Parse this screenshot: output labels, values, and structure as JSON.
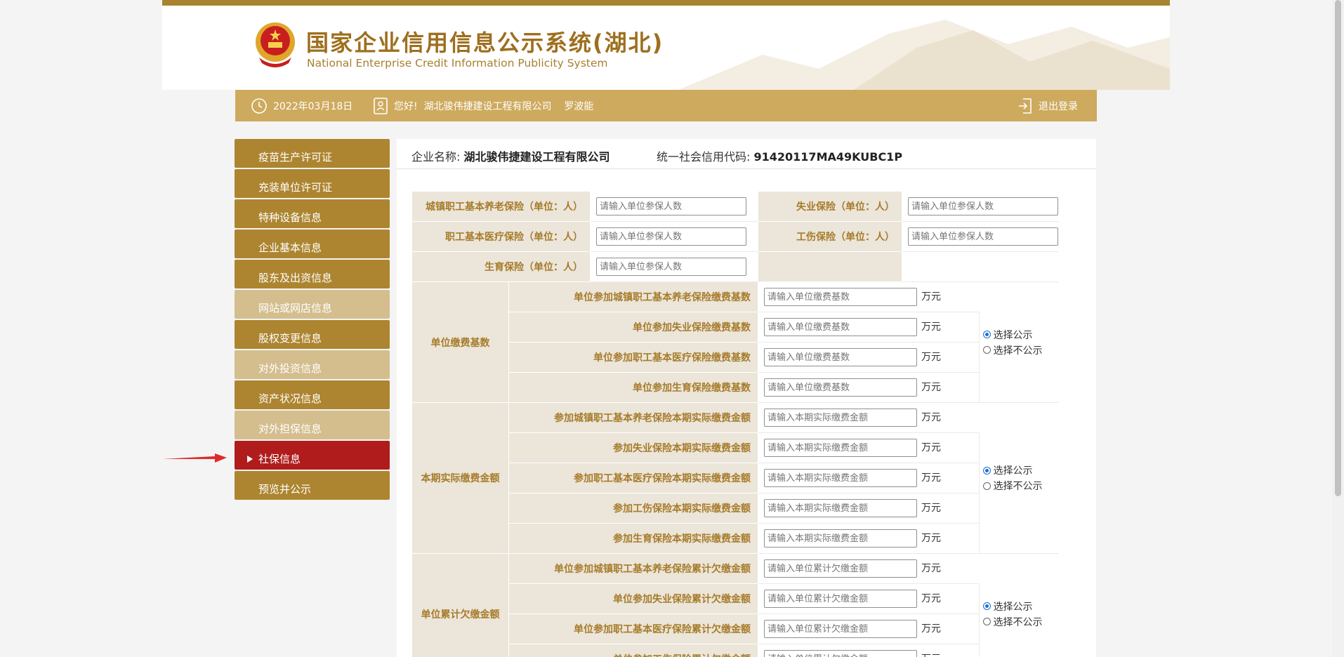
{
  "header": {
    "title_cn": "国家企业信用信息公示系统(湖北)",
    "title_en": "National Enterprise Credit Information Publicity System"
  },
  "infobar": {
    "date": "2022年03月18日",
    "greeting": "您好!  湖北骏伟捷建设工程有限公司    罗波能",
    "logout": "退出登录"
  },
  "sidebar": {
    "items": [
      {
        "label": "疫苗生产许可证"
      },
      {
        "label": "充装单位许可证"
      },
      {
        "label": "特种设备信息"
      },
      {
        "label": "企业基本信息"
      },
      {
        "label": "股东及出资信息"
      },
      {
        "label": "网站或网店信息"
      },
      {
        "label": "股权变更信息"
      },
      {
        "label": "对外投资信息"
      },
      {
        "label": "资产状况信息"
      },
      {
        "label": "对外担保信息"
      },
      {
        "label": "社保信息"
      },
      {
        "label": "预览并公示"
      }
    ]
  },
  "company": {
    "name_label": "企业名称:",
    "name": "湖北骏伟捷建设工程有限公司",
    "code_label": "统一社会信用代码:",
    "code": "91420117MA49KUBC1P"
  },
  "insured": {
    "pension_label": "城镇职工基本养老保险（单位：人）",
    "unemployment_label": "失业保险（单位：人）",
    "medical_label": "职工基本医疗保险（单位：人）",
    "injury_label": "工伤保险（单位：人）",
    "maternity_label": "生育保险（单位：人）",
    "placeholder": "请输入单位参保人数"
  },
  "base": {
    "group_label": "单位缴费基数",
    "rows": [
      "单位参加城镇职工基本养老保险缴费基数",
      "单位参加失业保险缴费基数",
      "单位参加职工基本医疗保险缴费基数",
      "单位参加生育保险缴费基数"
    ],
    "placeholder": "请输入单位缴费基数"
  },
  "actual": {
    "group_label": "本期实际缴费金额",
    "rows": [
      "参加城镇职工基本养老保险本期实际缴费金额",
      "参加失业保险本期实际缴费金额",
      "参加职工基本医疗保险本期实际缴费金额",
      "参加工伤保险本期实际缴费金额",
      "参加生育保险本期实际缴费金额"
    ],
    "placeholder": "请输入本期实际缴费金额"
  },
  "arrears": {
    "group_label": "单位累计欠缴金额",
    "rows": [
      "单位参加城镇职工基本养老保险累计欠缴金额",
      "单位参加失业保险累计欠缴金额",
      "单位参加职工基本医疗保险累计欠缴金额",
      "单位参加工伤保险累计欠缴金额"
    ],
    "placeholder": "请输入单位累计欠缴金额"
  },
  "common": {
    "unit": "万元",
    "publish": "选择公示",
    "no_publish": "选择不公示"
  },
  "colors": {
    "gold": "#ad8530",
    "light_gold": "#d4be8e",
    "active_red": "#b01c1c",
    "label_brown": "#a67c2a"
  }
}
